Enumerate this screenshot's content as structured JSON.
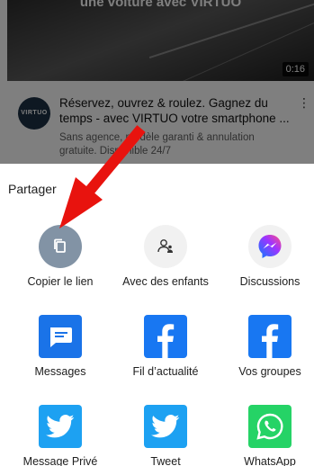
{
  "ad": {
    "video_headline": "une voiture avec VIRTUO",
    "duration": "0:16",
    "logo_text": "VIRTUO",
    "title": "Réservez, ouvrez & roulez. Gagnez du temps - avec VIRTUO votre smartphone ...",
    "description": "Sans agence, modèle garanti & annulation gratuite. Disponible 24/7"
  },
  "share_sheet": {
    "title": "Partager",
    "targets": [
      {
        "label": "Copier le lien",
        "icon": "copy-icon"
      },
      {
        "label": "Avec des enfants",
        "icon": "child-account-icon"
      },
      {
        "label": "Discussions",
        "icon": "messenger-icon"
      },
      {
        "label": "Messages",
        "icon": "messages-icon"
      },
      {
        "label": "Fil d’actualité",
        "icon": "facebook-icon"
      },
      {
        "label": "Vos groupes",
        "icon": "facebook-icon"
      },
      {
        "label": "Message Privé",
        "icon": "twitter-icon"
      },
      {
        "label": "Tweet",
        "icon": "twitter-icon"
      },
      {
        "label": "WhatsApp",
        "icon": "whatsapp-icon"
      }
    ]
  },
  "colors": {
    "copy_icon_bg": "#8293a5",
    "facebook": "#1877f2",
    "twitter": "#1da1f2",
    "whatsapp": "#25d366",
    "messages": "#1a73e8",
    "annotation_arrow": "#e8130e"
  }
}
